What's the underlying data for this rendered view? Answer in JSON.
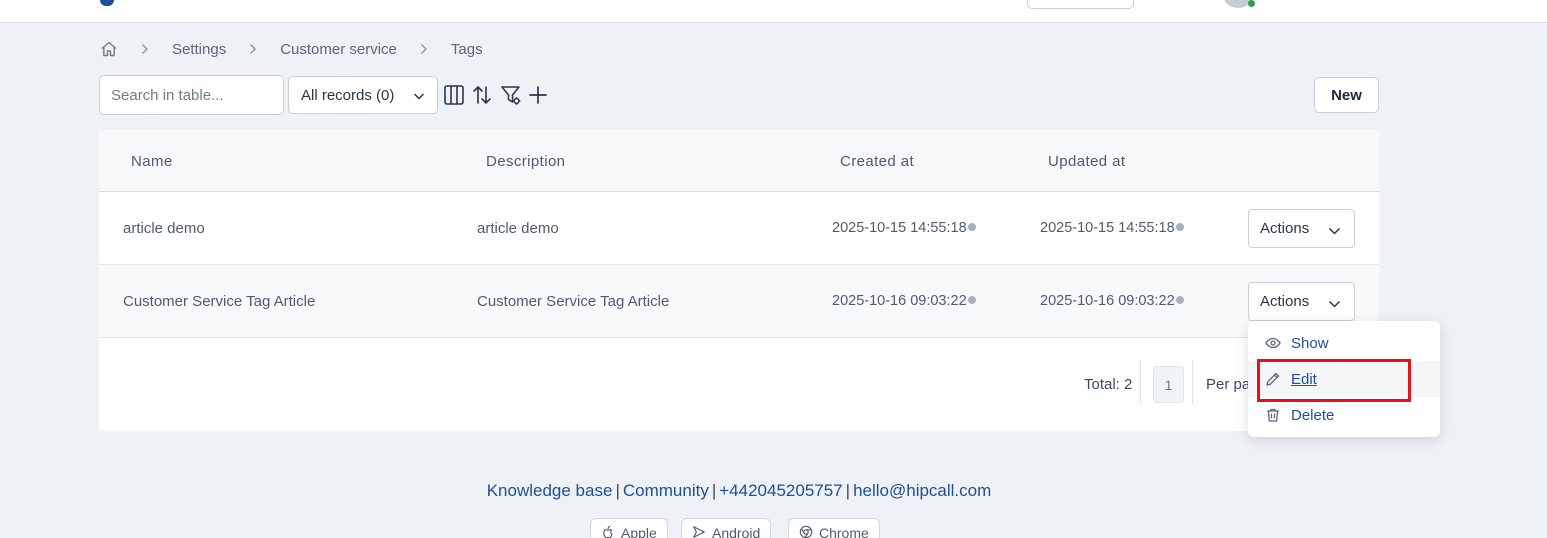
{
  "breadcrumb": {
    "items": [
      "Settings",
      "Customer service",
      "Tags"
    ]
  },
  "toolbar": {
    "search_placeholder": "Search in table...",
    "records_select": "All records (0)",
    "new_label": "New"
  },
  "table": {
    "columns": [
      "Name",
      "Description",
      "Created at",
      "Updated at"
    ],
    "rows": [
      {
        "name": "article demo",
        "description": "article demo",
        "created_at": "2025-10-15 14:55:18",
        "updated_at": "2025-10-15 14:55:18",
        "actions_label": "Actions"
      },
      {
        "name": "Customer Service Tag Article",
        "description": "Customer Service Tag Article",
        "created_at": "2025-10-16 09:03:22",
        "updated_at": "2025-10-16 09:03:22",
        "actions_label": "Actions"
      }
    ]
  },
  "pagination": {
    "total": "Total: 2",
    "current_page": "1",
    "per_page_label": "Per pa"
  },
  "actions_menu": {
    "items": [
      "Show",
      "Edit",
      "Delete"
    ],
    "highlighted": "Edit"
  },
  "footer": {
    "links": [
      "Knowledge base",
      "Community",
      "+442045205757",
      "hello@hipcall.com"
    ],
    "store_buttons": [
      "Apple",
      "Android",
      "Chrome"
    ]
  },
  "colors": {
    "background": "#eef1f5",
    "link": "#1f4f96",
    "highlight": "#e8101a",
    "status_online": "#2aa04a"
  }
}
